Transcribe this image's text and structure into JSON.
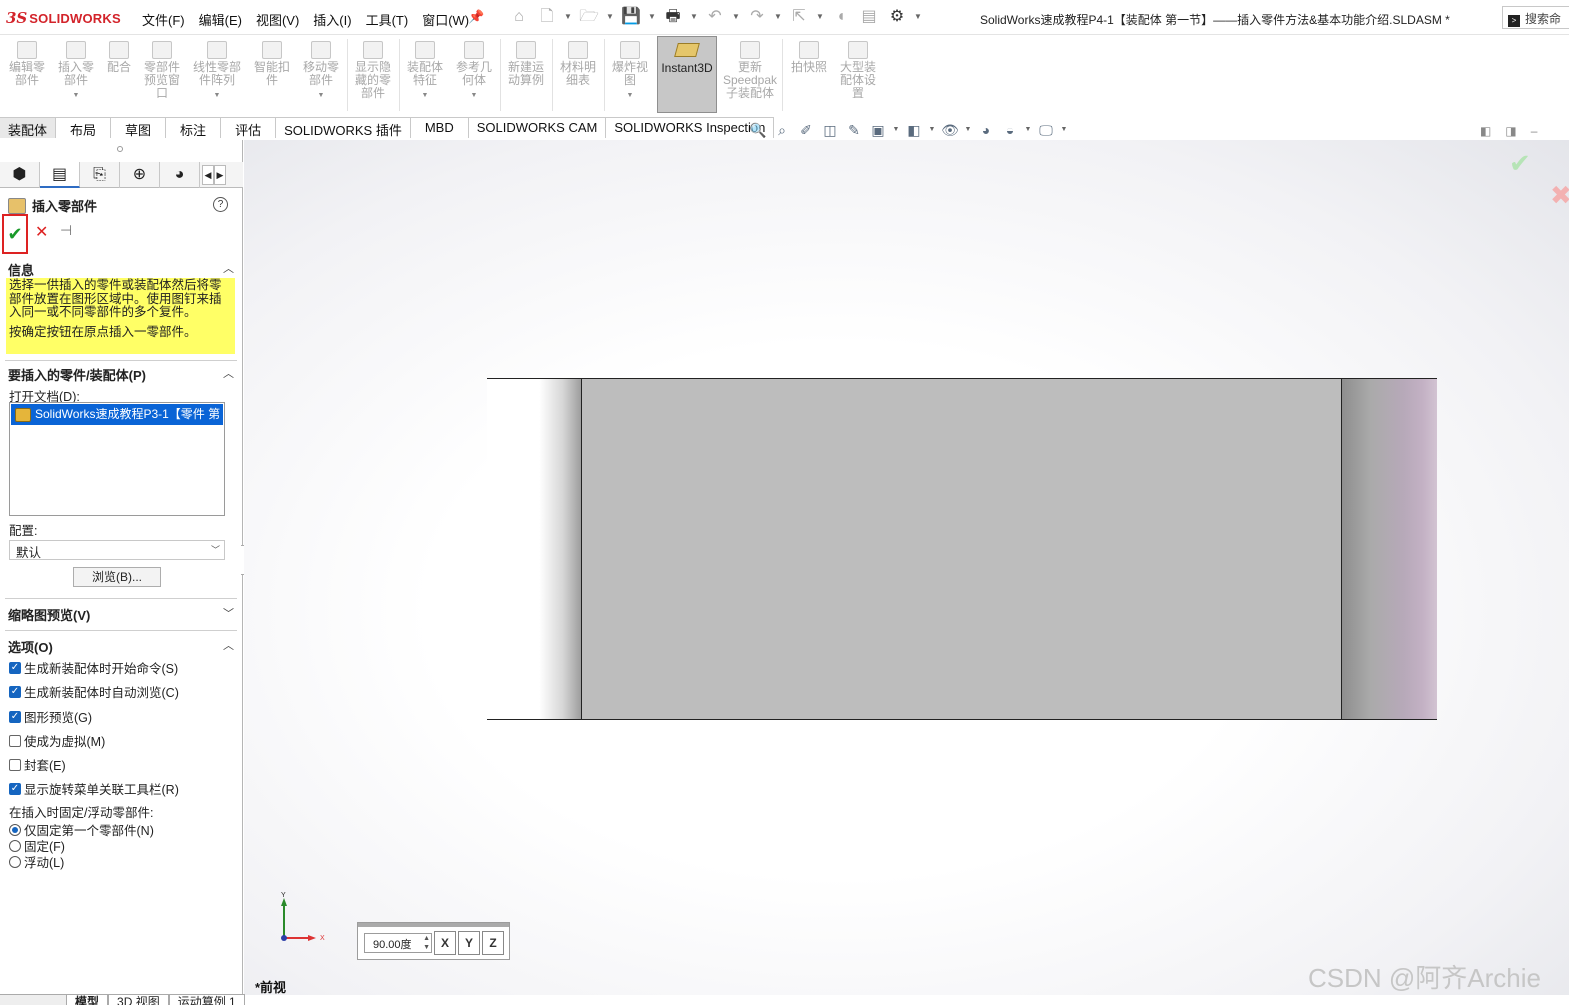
{
  "app": {
    "brand": "SOLIDWORKS",
    "logo_mark": "3S"
  },
  "menus": [
    "文件(F)",
    "编辑(E)",
    "视图(V)",
    "插入(I)",
    "工具(T)",
    "窗口(W)"
  ],
  "document_title": "SolidWorks速成教程P4-1【装配体  第一节】——插入零件方法&基本功能介绍.SLDASM *",
  "search": {
    "label": "搜索命"
  },
  "ribbon": {
    "edit_component": "编辑零部件",
    "insert_component": "插入零部件",
    "mate": "配合",
    "component_preview": "零部件预览窗口",
    "linear_pattern": "线性零部件阵列",
    "smart_fastener": "智能扣件",
    "move_component": "移动零部件",
    "show_hidden": "显示隐藏的零部件",
    "assembly_feature": "装配体特征",
    "reference_geometry": "参考几何体",
    "new_motion_study": "新建运动算例",
    "bom": "材料明细表",
    "exploded_view": "爆炸视图",
    "instant3d": "Instant3D",
    "update_speedpak": "更新Speedpak子装配体",
    "snapshot": "拍快照",
    "large_assembly": "大型装配体设置"
  },
  "command_tabs": [
    "装配体",
    "布局",
    "草图",
    "标注",
    "评估",
    "SOLIDWORKS 插件",
    "MBD",
    "SOLIDWORKS CAM",
    "SOLIDWORKS Inspection"
  ],
  "property_manager": {
    "title": "插入零部件",
    "info_header": "信息",
    "info_text_1": "选择一供插入的零件或装配体然后将零部件放置在图形区域中。使用图钉来插入同一或不同零部件的多个复件。",
    "info_text_2": "按确定按钮在原点插入一零部件。",
    "part_section_header": "要插入的零件/装配体(P)",
    "open_documents_label": "打开文档(D):",
    "open_documents": [
      "SolidWorks速成教程P3-1【零件 第"
    ],
    "config_label": "配置:",
    "config_value": "默认",
    "browse_button": "浏览(B)...",
    "thumbnail_header": "缩略图预览(V)",
    "options_header": "选项(O)",
    "options": [
      {
        "label": "生成新装配体时开始命令(S)",
        "checked": true
      },
      {
        "label": "生成新装配体时自动浏览(C)",
        "checked": true
      },
      {
        "label": "图形预览(G)",
        "checked": true
      },
      {
        "label": "使成为虚拟(M)",
        "checked": false
      },
      {
        "label": "封套(E)",
        "checked": false
      },
      {
        "label": "显示旋转菜单关联工具栏(R)",
        "checked": true
      }
    ],
    "fix_float_label": "在插入时固定/浮动零部件:",
    "radios": [
      {
        "label": "仅固定第一个零部件(N)",
        "selected": true
      },
      {
        "label": "固定(F)",
        "selected": false
      },
      {
        "label": "浮动(L)",
        "selected": false
      }
    ]
  },
  "graphics": {
    "rotate_value": "90.00度",
    "axis_buttons": [
      "X",
      "Y",
      "Z"
    ],
    "triad_y": "Y",
    "triad_x": "X",
    "view_name": "*前视"
  },
  "bottom_tabs": [
    "模型",
    "3D 视图",
    "运动算例 1"
  ],
  "watermark": "CSDN @阿齐Archie"
}
